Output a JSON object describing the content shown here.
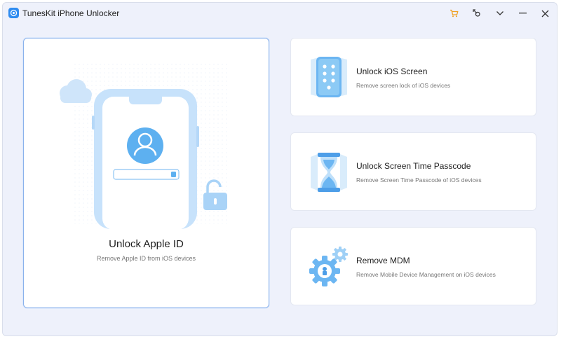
{
  "window": {
    "title": "TunesKit iPhone Unlocker",
    "controls": {
      "cart": "cart-icon",
      "feedback": "feedback-icon",
      "menu": "chevron-down-icon",
      "minimize": "minimize-icon",
      "close": "close-icon"
    }
  },
  "main_card": {
    "title": "Unlock Apple ID",
    "subtitle": "Remove Apple ID from iOS devices"
  },
  "options": [
    {
      "title": "Unlock iOS Screen",
      "subtitle": "Remove screen lock of iOS devices",
      "icon": "phone-keypad-icon"
    },
    {
      "title": "Unlock Screen Time Passcode",
      "subtitle": "Remove Screen Time Passcode of iOS devices",
      "icon": "hourglass-icon"
    },
    {
      "title": "Remove MDM",
      "subtitle": "Remove Mobile Device Management on iOS devices",
      "icon": "gears-icon"
    }
  ],
  "colors": {
    "accent": "#2f8cf0",
    "icon_blue": "#6cb6f2",
    "cart": "#f0a020",
    "background": "#eef1fb"
  }
}
